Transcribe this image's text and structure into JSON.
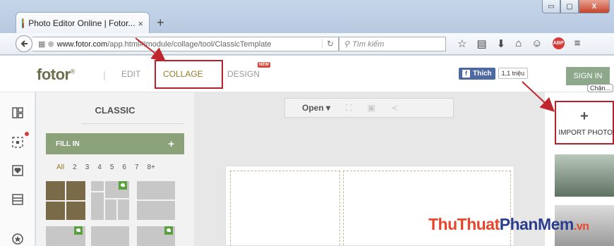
{
  "browser": {
    "tab_title": "Photo Editor Online | Fotor...",
    "tab_close": "×",
    "new_tab": "+",
    "url_host": "www.fotor.com",
    "url_path": "/app.html#!module/collage/tool/ClassicTemplate",
    "search_placeholder": "Tìm kiếm",
    "window_buttons": [
      "▭",
      "▢",
      "X"
    ]
  },
  "app": {
    "logo": "fotor",
    "logo_mark": "®",
    "nav": {
      "edit": "EDIT",
      "collage": "COLLAGE",
      "design": "DESIGN",
      "new_badge": "NEW"
    },
    "facebook": {
      "like_label": "Thích",
      "like_count": "1,1 triệu"
    },
    "signin": "SIGN IN",
    "popup_tag": "Chặn..."
  },
  "panel": {
    "title": "CLASSIC",
    "fill_in": "FILL IN",
    "fill_in_plus": "+",
    "filters": [
      "All",
      "2",
      "3",
      "4",
      "5",
      "6",
      "7",
      "8+"
    ]
  },
  "canvas": {
    "open_label": "Open",
    "open_caret": "▾"
  },
  "right_panel": {
    "import_plus": "+",
    "import_label": "IMPORT PHOTOS"
  },
  "watermark": {
    "part1": "ThuThuat",
    "part2": "PhanMem",
    "part3": ".vn"
  },
  "colors": {
    "accent_gold": "#9a7a2c",
    "callout_red": "#b5202a",
    "fill_green": "#8aa17a"
  }
}
